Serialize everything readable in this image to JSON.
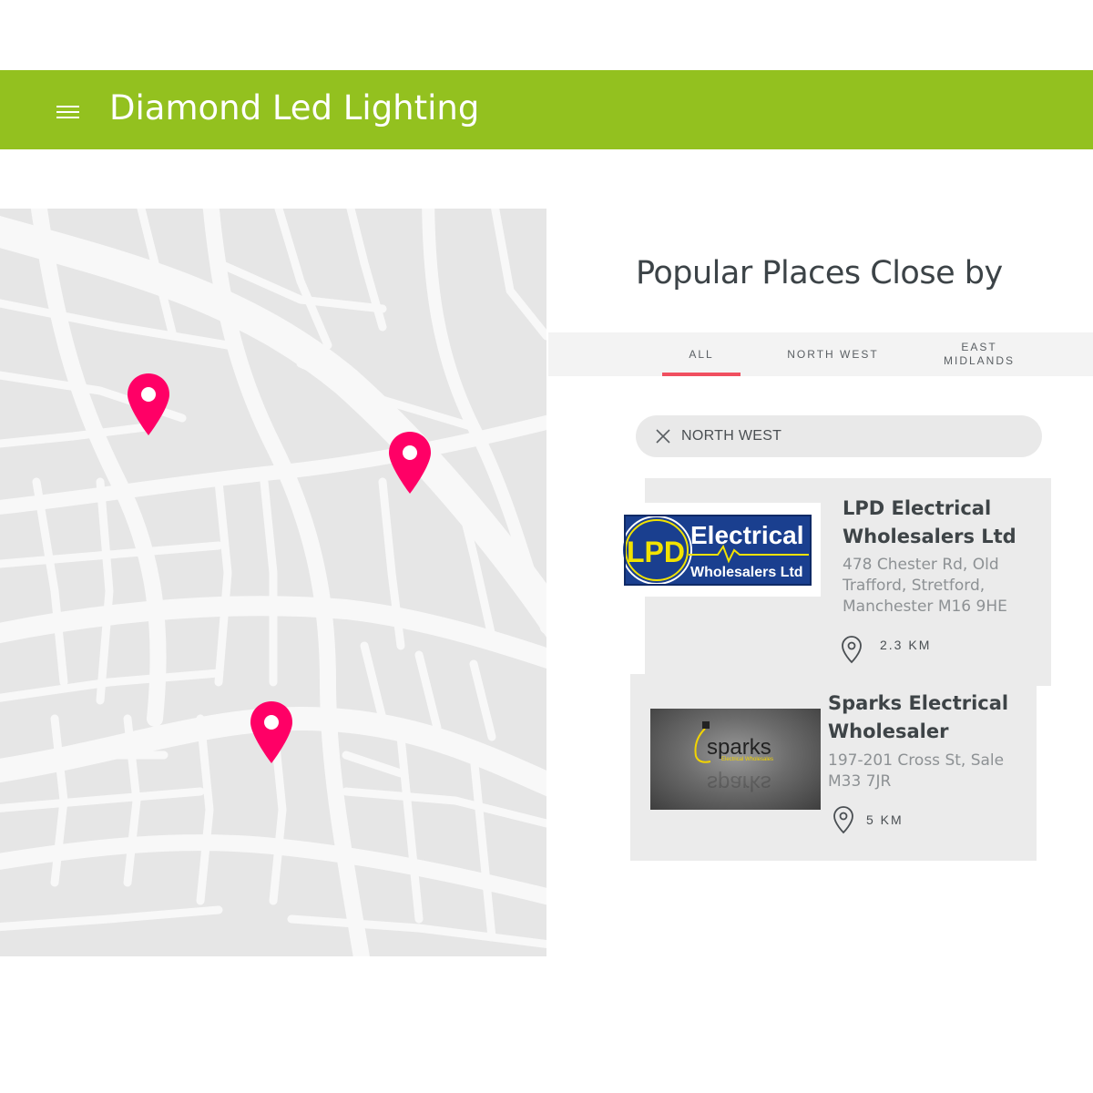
{
  "header": {
    "title": "Diamond Led Lighting",
    "bg_color": "#93c11f"
  },
  "map": {
    "pin_color": "#ff0066",
    "pin_count": 3
  },
  "panel": {
    "title": "Popular Places Close by",
    "tabs": [
      {
        "label": "ALL",
        "active": true
      },
      {
        "label": "NORTH WEST",
        "active": false
      },
      {
        "label": "EAST MIDLANDS",
        "active": false
      }
    ],
    "active_tab_color": "#f04f5f",
    "filter_chip": {
      "label": "NORTH WEST",
      "icon": "close-icon"
    }
  },
  "places": [
    {
      "name": "LPD Electrical Wholesalers Ltd",
      "address": "478 Chester Rd, Old Trafford, Stretford, Manchester M16 9HE",
      "distance": "2.3 KM",
      "logo": {
        "left_text": "LPD",
        "top_text": "Electrical",
        "bottom_text": "Wholesalers Ltd"
      }
    },
    {
      "name": "Sparks Electrical Wholesaler",
      "address": "197-201 Cross St, Sale M33 7JR",
      "distance": "5 KM",
      "logo": {
        "main_text": "sparks",
        "sub_text": "Electrical Wholesales"
      }
    }
  ]
}
